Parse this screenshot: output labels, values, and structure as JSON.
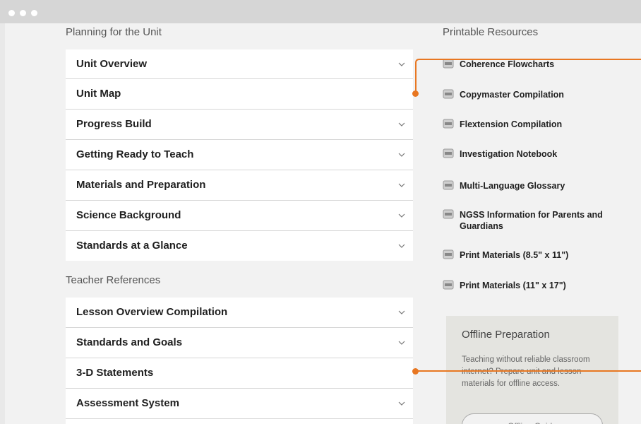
{
  "window": {
    "controls": [
      "close",
      "minimize",
      "maximize"
    ]
  },
  "planning": {
    "title": "Planning for the Unit",
    "items": [
      {
        "label": "Unit Overview"
      },
      {
        "label": "Unit Map"
      },
      {
        "label": "Progress Build"
      },
      {
        "label": "Getting Ready to Teach"
      },
      {
        "label": "Materials and Preparation"
      },
      {
        "label": "Science Background"
      },
      {
        "label": "Standards at a Glance"
      }
    ]
  },
  "teacher": {
    "title": "Teacher References",
    "items": [
      {
        "label": "Lesson Overview Compilation"
      },
      {
        "label": "Standards and Goals"
      },
      {
        "label": "3-D Statements"
      },
      {
        "label": "Assessment System"
      }
    ]
  },
  "resources": {
    "title": "Printable Resources",
    "icon": "pdf-icon",
    "items": [
      {
        "label": "Coherence Flowcharts"
      },
      {
        "label": "Copymaster Compilation"
      },
      {
        "label": "Flextension Compilation"
      },
      {
        "label": "Investigation Notebook"
      },
      {
        "label": "Multi-Language Glossary"
      },
      {
        "label": "NGSS Information for Parents and Guardians"
      },
      {
        "label": "Print Materials (8.5\" x 11\")"
      },
      {
        "label": "Print Materials (11\" x 17\")"
      }
    ]
  },
  "offline": {
    "title": "Offline Preparation",
    "text": "Teaching without reliable classroom internet? Prepare unit and lesson materials for offline access.",
    "button_label": "Offline Guide"
  },
  "colors": {
    "accent": "#e87722",
    "card": "#ffffff",
    "background": "#f2f2f2"
  }
}
